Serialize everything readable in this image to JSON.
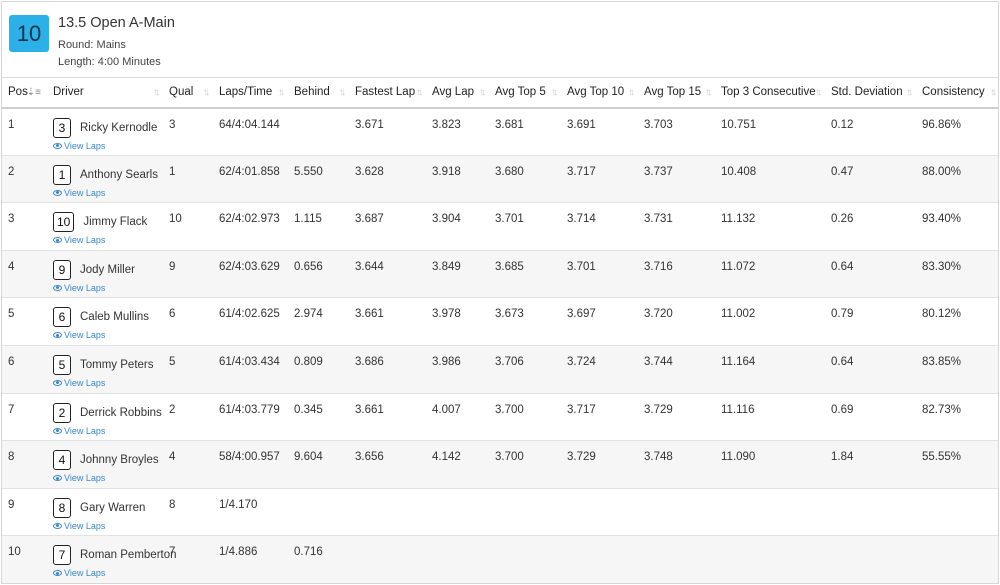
{
  "race": {
    "number": "10",
    "title": "13.5 Open A-Main",
    "round": "Round: Mains",
    "length": "Length: 4:00 Minutes"
  },
  "view_laps_label": "View Laps",
  "columns": [
    "Pos",
    "Driver",
    "Qual",
    "Laps/Time",
    "Behind",
    "Fastest Lap",
    "Avg Lap",
    "Avg Top 5",
    "Avg Top 10",
    "Avg Top 15",
    "Top 3 Consecutive",
    "Std. Deviation",
    "Consistency"
  ],
  "rows": [
    {
      "pos": "1",
      "car": "3",
      "driver": "Ricky Kernodle",
      "qual": "3",
      "laps": "64/4:04.144",
      "behind": "",
      "fastest": "3.671",
      "avg": "3.823",
      "top5": "3.681",
      "top10": "3.691",
      "top15": "3.703",
      "top3c": "10.751",
      "std": "0.12",
      "cons": "96.86%"
    },
    {
      "pos": "2",
      "car": "1",
      "driver": "Anthony Searls",
      "qual": "1",
      "laps": "62/4:01.858",
      "behind": "5.550",
      "fastest": "3.628",
      "avg": "3.918",
      "top5": "3.680",
      "top10": "3.717",
      "top15": "3.737",
      "top3c": "10.408",
      "std": "0.47",
      "cons": "88.00%"
    },
    {
      "pos": "3",
      "car": "10",
      "driver": "Jimmy Flack",
      "qual": "10",
      "laps": "62/4:02.973",
      "behind": "1.115",
      "fastest": "3.687",
      "avg": "3.904",
      "top5": "3.701",
      "top10": "3.714",
      "top15": "3.731",
      "top3c": "11.132",
      "std": "0.26",
      "cons": "93.40%"
    },
    {
      "pos": "4",
      "car": "9",
      "driver": "Jody Miller",
      "qual": "9",
      "laps": "62/4:03.629",
      "behind": "0.656",
      "fastest": "3.644",
      "avg": "3.849",
      "top5": "3.685",
      "top10": "3.701",
      "top15": "3.716",
      "top3c": "11.072",
      "std": "0.64",
      "cons": "83.30%"
    },
    {
      "pos": "5",
      "car": "6",
      "driver": "Caleb Mullins",
      "qual": "6",
      "laps": "61/4:02.625",
      "behind": "2.974",
      "fastest": "3.661",
      "avg": "3.978",
      "top5": "3.673",
      "top10": "3.697",
      "top15": "3.720",
      "top3c": "11.002",
      "std": "0.79",
      "cons": "80.12%"
    },
    {
      "pos": "6",
      "car": "5",
      "driver": "Tommy Peters",
      "qual": "5",
      "laps": "61/4:03.434",
      "behind": "0.809",
      "fastest": "3.686",
      "avg": "3.986",
      "top5": "3.706",
      "top10": "3.724",
      "top15": "3.744",
      "top3c": "11.164",
      "std": "0.64",
      "cons": "83.85%"
    },
    {
      "pos": "7",
      "car": "2",
      "driver": "Derrick Robbins",
      "qual": "2",
      "laps": "61/4:03.779",
      "behind": "0.345",
      "fastest": "3.661",
      "avg": "4.007",
      "top5": "3.700",
      "top10": "3.717",
      "top15": "3.729",
      "top3c": "11.116",
      "std": "0.69",
      "cons": "82.73%"
    },
    {
      "pos": "8",
      "car": "4",
      "driver": "Johnny Broyles",
      "qual": "4",
      "laps": "58/4:00.957",
      "behind": "9.604",
      "fastest": "3.656",
      "avg": "4.142",
      "top5": "3.700",
      "top10": "3.729",
      "top15": "3.748",
      "top3c": "11.090",
      "std": "1.84",
      "cons": "55.55%"
    },
    {
      "pos": "9",
      "car": "8",
      "driver": "Gary Warren",
      "qual": "8",
      "laps": "1/4.170",
      "behind": "",
      "fastest": "",
      "avg": "",
      "top5": "",
      "top10": "",
      "top15": "",
      "top3c": "",
      "std": "",
      "cons": ""
    },
    {
      "pos": "10",
      "car": "7",
      "driver": "Roman Pemberton",
      "qual": "7",
      "laps": "1/4.886",
      "behind": "0.716",
      "fastest": "",
      "avg": "",
      "top5": "",
      "top10": "",
      "top15": "",
      "top3c": "",
      "std": "",
      "cons": ""
    }
  ],
  "colors": {
    "badge": "#2bb0e8",
    "link": "#3a87c8",
    "row_alt": "#f6f6f6"
  }
}
